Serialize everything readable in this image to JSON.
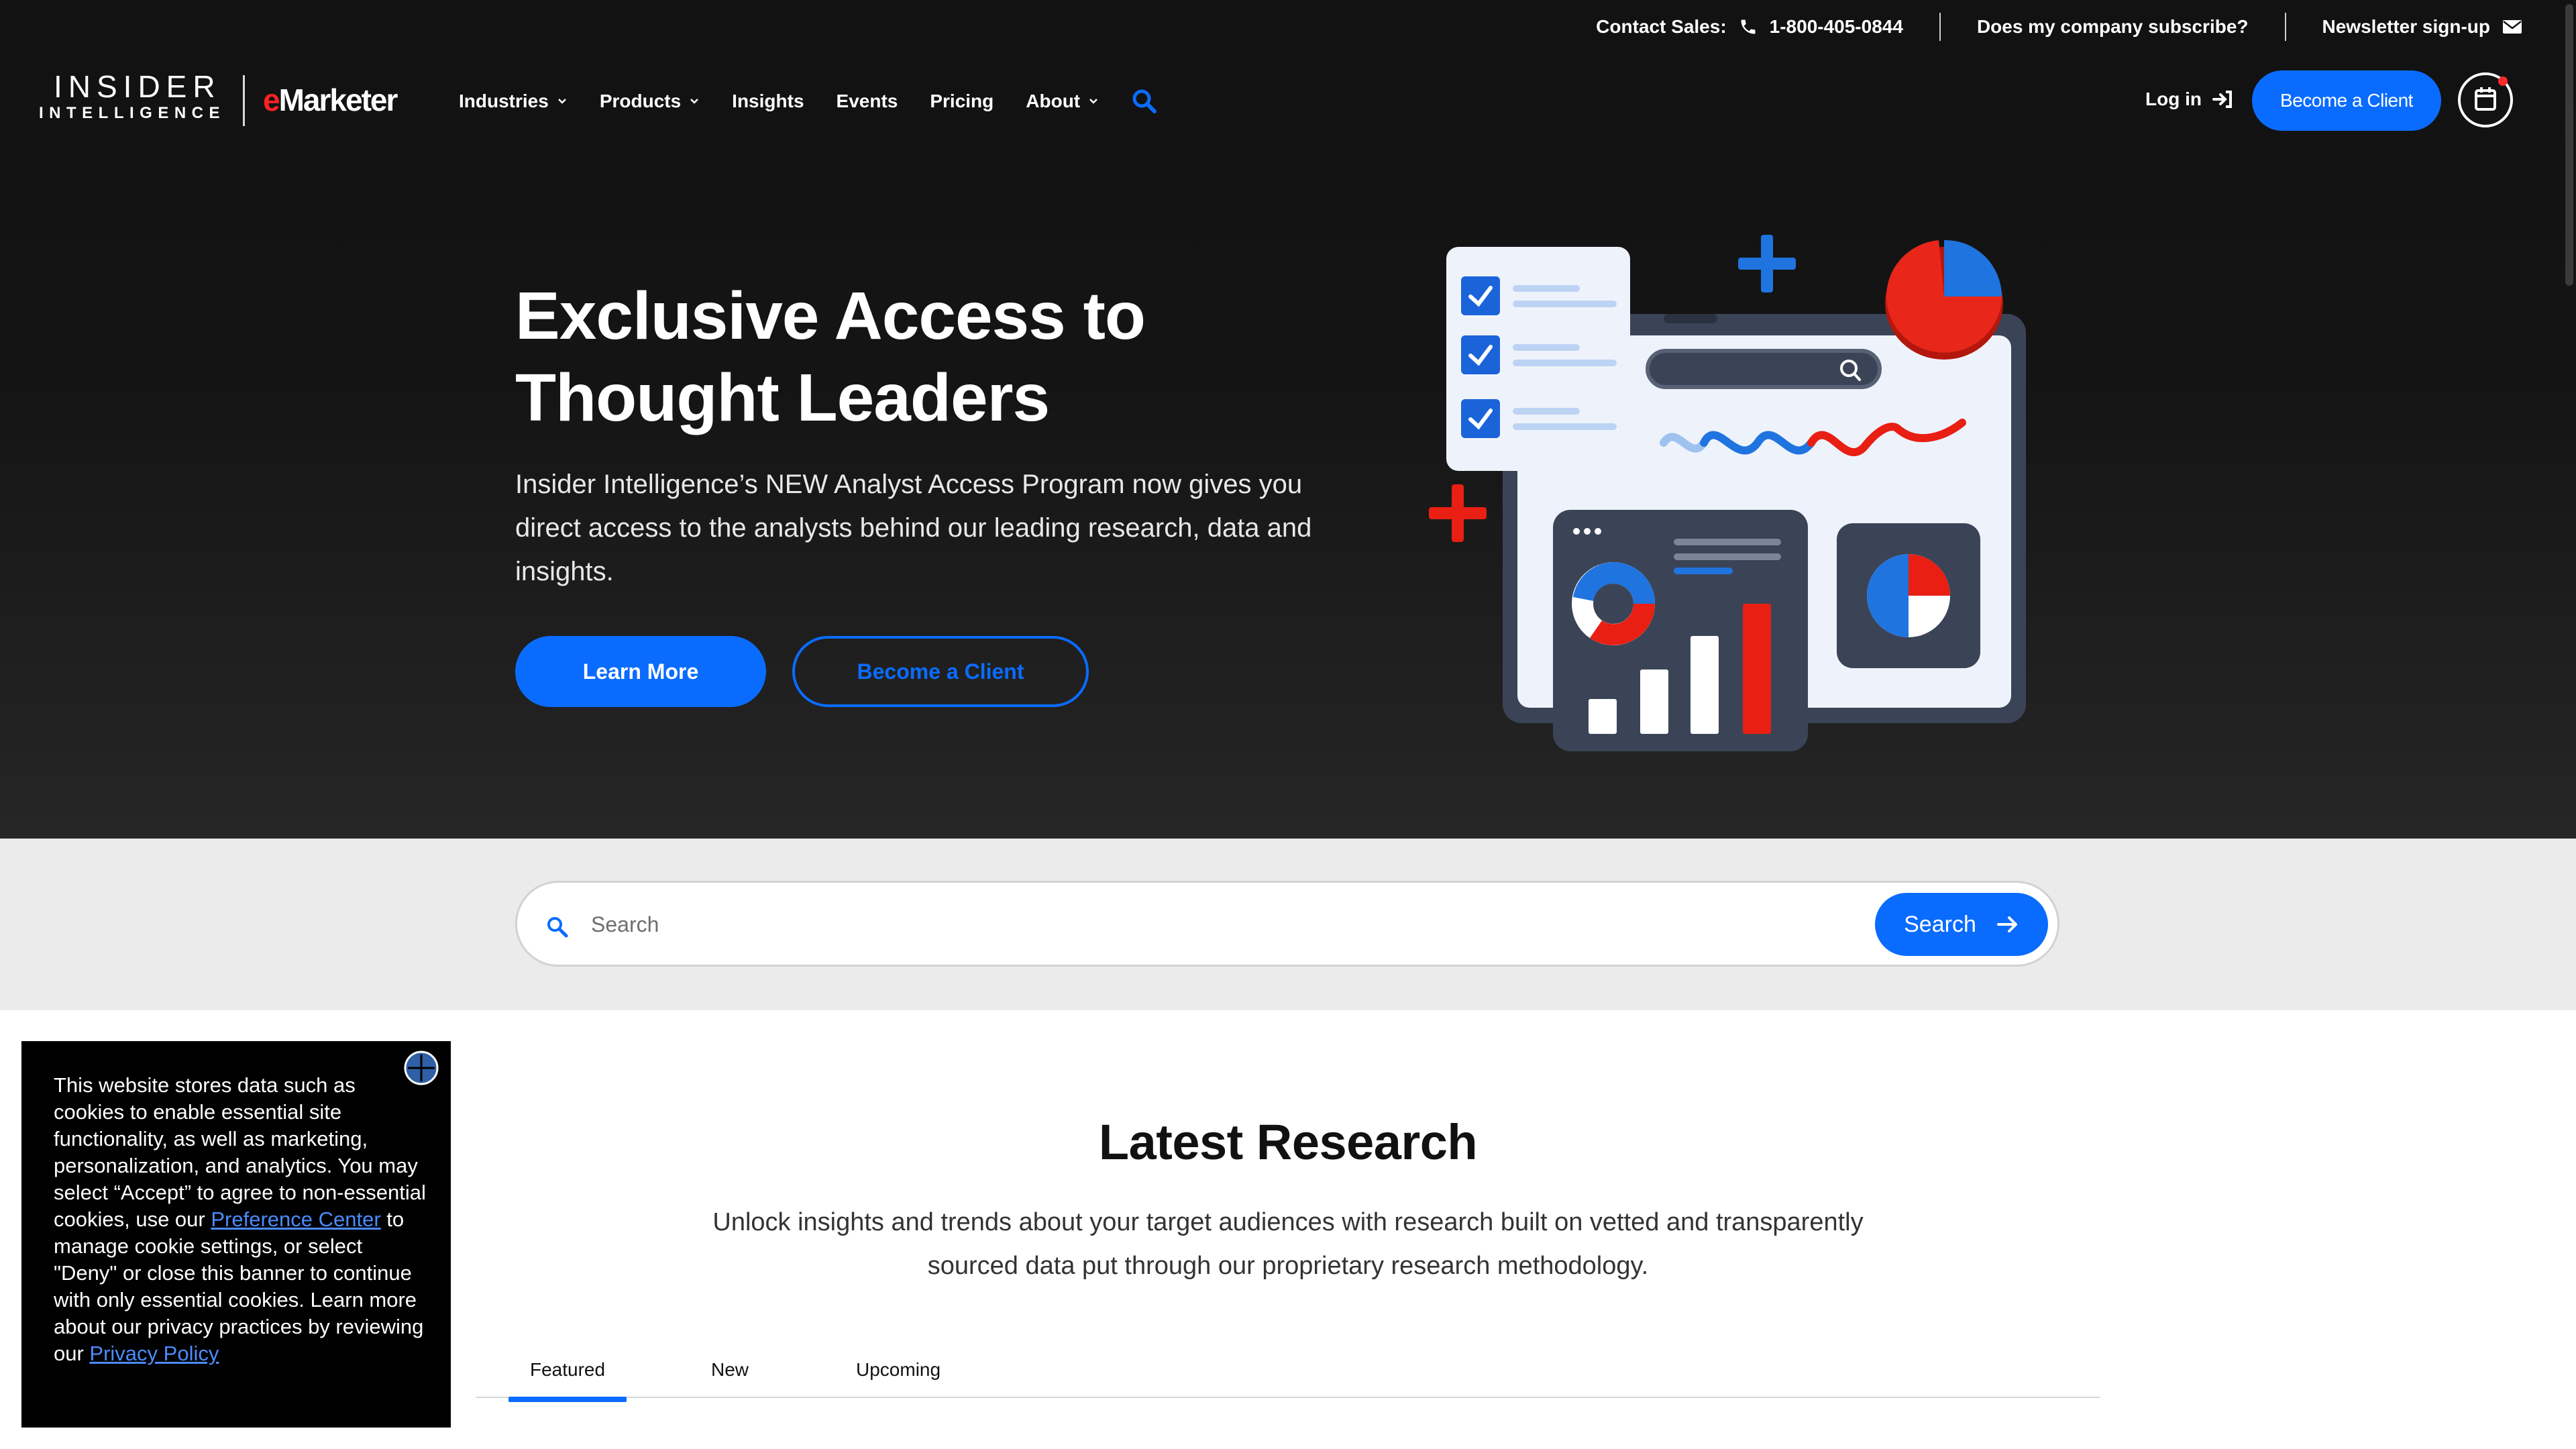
{
  "utility": {
    "contact_label": "Contact Sales:",
    "phone": "1-800-405-0844",
    "subscribe": "Does my company subscribe?",
    "newsletter": "Newsletter sign-up"
  },
  "brand": {
    "ii_line1": "INSIDER",
    "ii_line2": "INTELLIGENCE",
    "em_e": "e",
    "em_rest": "Marketer"
  },
  "nav": {
    "items": [
      {
        "label": "Industries",
        "has_dropdown": true
      },
      {
        "label": "Products",
        "has_dropdown": true
      },
      {
        "label": "Insights",
        "has_dropdown": false
      },
      {
        "label": "Events",
        "has_dropdown": false
      },
      {
        "label": "Pricing",
        "has_dropdown": false
      },
      {
        "label": "About",
        "has_dropdown": true
      }
    ],
    "login": "Log in",
    "become_client": "Become a Client"
  },
  "hero": {
    "title_line1": "Exclusive Access to",
    "title_line2": "Thought Leaders",
    "subtitle": "Insider Intelligence’s NEW Analyst Access Program now gives you direct access to the analysts behind our leading research, data and insights.",
    "learn_more": "Learn More",
    "become_client": "Become a Client"
  },
  "search": {
    "placeholder": "Search",
    "button": "Search"
  },
  "latest": {
    "title": "Latest Research",
    "subtitle_line1": "Unlock insights and trends about your target audiences with research built on vetted and transparently",
    "subtitle_line2": "sourced data put through our proprietary research methodology.",
    "tabs": [
      {
        "label": "Featured",
        "active": true
      },
      {
        "label": "New",
        "active": false
      },
      {
        "label": "Upcoming",
        "active": false
      }
    ]
  },
  "cookie": {
    "text_1": "This website stores data such as cookies to enable essential site functionality, as well as marketing, personalization, and analytics. You may select “Accept” to agree to non-essential cookies, use our ",
    "link_preference": "Preference Center",
    "text_2": " to manage cookie settings, or select \"Deny\" or close this banner to continue with only essential cookies. Learn more about our privacy practices by reviewing our ",
    "link_privacy": "Privacy Policy"
  },
  "colors": {
    "accent": "#0a6cff",
    "hero_bg": "#141414",
    "brand_red": "#ff2222",
    "search_strip": "#ebebeb"
  },
  "icons": [
    "phone-icon",
    "mail-icon",
    "chevron-down-icon",
    "search-icon",
    "login-arrow-icon",
    "calendar-icon",
    "arrow-right-icon",
    "close-icon"
  ]
}
